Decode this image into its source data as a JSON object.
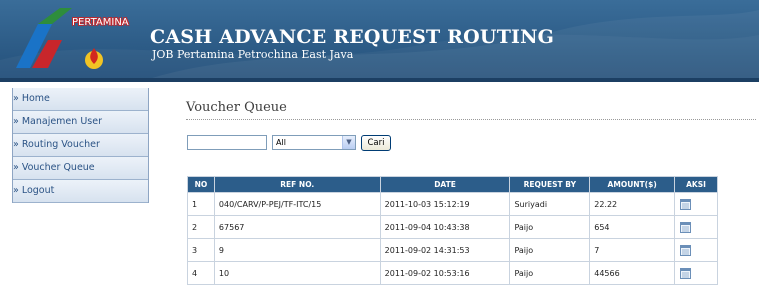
{
  "header": {
    "logo_text": "PERTAMINA",
    "title": "CASH ADVANCE REQUEST ROUTING",
    "subtitle": "JOB Pertamina Petrochina East Java"
  },
  "sidebar": {
    "items": [
      {
        "label": "» Home"
      },
      {
        "label": "» Manajemen User"
      },
      {
        "label": "» Routing Voucher"
      },
      {
        "label": "» Voucher Queue"
      },
      {
        "label": "» Logout"
      }
    ]
  },
  "main": {
    "page_title": "Voucher Queue",
    "search": {
      "value": "",
      "placeholder": ""
    },
    "filter": {
      "selected": "All"
    },
    "search_button": "Cari",
    "table": {
      "columns": [
        "NO",
        "REF NO.",
        "DATE",
        "REQUEST BY",
        "AMOUNT($)",
        "AKSI"
      ],
      "rows": [
        {
          "no": "1",
          "ref": "040/CARV/P-PEJ/TF-ITC/15",
          "date": "2011-10-03 15:12:19",
          "by": "Suriyadi",
          "amount": "22.22"
        },
        {
          "no": "2",
          "ref": "67567",
          "date": "2011-09-04 10:43:38",
          "by": "Paijo",
          "amount": "654"
        },
        {
          "no": "3",
          "ref": "9",
          "date": "2011-09-02 14:31:53",
          "by": "Paijo",
          "amount": "7"
        },
        {
          "no": "4",
          "ref": "10",
          "date": "2011-09-02 10:53:16",
          "by": "Paijo",
          "amount": "44566"
        }
      ]
    }
  },
  "colors": {
    "header_blue": "#2d5c87",
    "table_header": "#2c5d8a",
    "sidebar_text": "#2b5385"
  },
  "icons": {
    "action_icon": "calendar-icon",
    "dropdown_icon": "chevron-down-icon"
  }
}
